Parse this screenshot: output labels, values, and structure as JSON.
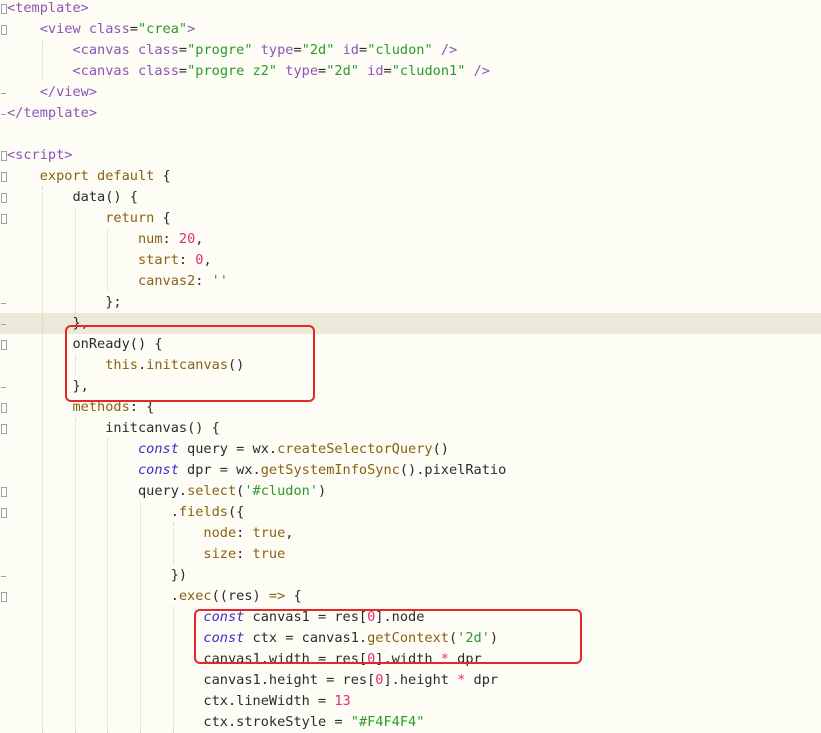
{
  "editor": {
    "lines": [
      [
        {
          "t": "<template>",
          "c": "tag"
        }
      ],
      [
        {
          "t": "    "
        },
        {
          "t": "<view ",
          "c": "tag"
        },
        {
          "t": "class",
          "c": "attr"
        },
        {
          "t": "=",
          "c": "punc"
        },
        {
          "t": "\"crea\"",
          "c": "str"
        },
        {
          "t": ">",
          "c": "tag"
        }
      ],
      [
        {
          "t": "        "
        },
        {
          "t": "<canvas ",
          "c": "tag"
        },
        {
          "t": "class",
          "c": "attr"
        },
        {
          "t": "=",
          "c": "punc"
        },
        {
          "t": "\"progre\"",
          "c": "str"
        },
        {
          "t": " "
        },
        {
          "t": "type",
          "c": "attr"
        },
        {
          "t": "=",
          "c": "punc"
        },
        {
          "t": "\"2d\"",
          "c": "str"
        },
        {
          "t": " "
        },
        {
          "t": "id",
          "c": "attr"
        },
        {
          "t": "=",
          "c": "punc"
        },
        {
          "t": "\"cludon\"",
          "c": "str"
        },
        {
          "t": " />",
          "c": "tag"
        }
      ],
      [
        {
          "t": "        "
        },
        {
          "t": "<canvas ",
          "c": "tag"
        },
        {
          "t": "class",
          "c": "attr"
        },
        {
          "t": "=",
          "c": "punc"
        },
        {
          "t": "\"progre z2\"",
          "c": "str"
        },
        {
          "t": " "
        },
        {
          "t": "type",
          "c": "attr"
        },
        {
          "t": "=",
          "c": "punc"
        },
        {
          "t": "\"2d\"",
          "c": "str"
        },
        {
          "t": " "
        },
        {
          "t": "id",
          "c": "attr"
        },
        {
          "t": "=",
          "c": "punc"
        },
        {
          "t": "\"cludon1\"",
          "c": "str"
        },
        {
          "t": " />",
          "c": "tag"
        }
      ],
      [
        {
          "t": "    "
        },
        {
          "t": "</view>",
          "c": "tag"
        }
      ],
      [
        {
          "t": "</template>",
          "c": "tag"
        }
      ],
      [],
      [
        {
          "t": "<script>",
          "c": "tag"
        }
      ],
      [
        {
          "t": "    "
        },
        {
          "t": "export default",
          "c": "kw"
        },
        {
          "t": " {",
          "c": "punc"
        }
      ],
      [
        {
          "t": "        "
        },
        {
          "t": "data",
          "c": "plain"
        },
        {
          "t": "() {",
          "c": "punc"
        }
      ],
      [
        {
          "t": "            "
        },
        {
          "t": "return",
          "c": "kw"
        },
        {
          "t": " {",
          "c": "punc"
        }
      ],
      [
        {
          "t": "                "
        },
        {
          "t": "num",
          "c": "prop"
        },
        {
          "t": ": ",
          "c": "punc"
        },
        {
          "t": "20",
          "c": "num"
        },
        {
          "t": ",",
          "c": "punc"
        }
      ],
      [
        {
          "t": "                "
        },
        {
          "t": "start",
          "c": "prop"
        },
        {
          "t": ": ",
          "c": "punc"
        },
        {
          "t": "0",
          "c": "num"
        },
        {
          "t": ",",
          "c": "punc"
        }
      ],
      [
        {
          "t": "                "
        },
        {
          "t": "canvas2",
          "c": "prop"
        },
        {
          "t": ": ",
          "c": "punc"
        },
        {
          "t": "''",
          "c": "str"
        }
      ],
      [
        {
          "t": "            "
        },
        {
          "t": "};",
          "c": "punc"
        }
      ],
      [
        {
          "t": "        "
        },
        {
          "t": "},",
          "c": "punc"
        }
      ],
      [
        {
          "t": "        "
        },
        {
          "t": "onReady",
          "c": "plain"
        },
        {
          "t": "() {",
          "c": "punc"
        }
      ],
      [
        {
          "t": "            "
        },
        {
          "t": "this",
          "c": "kw"
        },
        {
          "t": ".",
          "c": "punc"
        },
        {
          "t": "initcanvas",
          "c": "fn"
        },
        {
          "t": "()",
          "c": "punc"
        }
      ],
      [
        {
          "t": "        "
        },
        {
          "t": "},",
          "c": "punc"
        }
      ],
      [
        {
          "t": "        "
        },
        {
          "t": "methods",
          "c": "prop"
        },
        {
          "t": ": {",
          "c": "punc"
        }
      ],
      [
        {
          "t": "            "
        },
        {
          "t": "initcanvas",
          "c": "plain"
        },
        {
          "t": "() {",
          "c": "punc"
        }
      ],
      [
        {
          "t": "                "
        },
        {
          "t": "const",
          "c": "type"
        },
        {
          "t": " query = wx.",
          "c": "plain"
        },
        {
          "t": "createSelectorQuery",
          "c": "fn"
        },
        {
          "t": "()",
          "c": "punc"
        }
      ],
      [
        {
          "t": "                "
        },
        {
          "t": "const",
          "c": "type"
        },
        {
          "t": " dpr = wx.",
          "c": "plain"
        },
        {
          "t": "getSystemInfoSync",
          "c": "fn"
        },
        {
          "t": "().pixelRatio",
          "c": "plain"
        }
      ],
      [
        {
          "t": "                "
        },
        {
          "t": "query.",
          "c": "plain"
        },
        {
          "t": "select",
          "c": "fn"
        },
        {
          "t": "(",
          "c": "punc"
        },
        {
          "t": "'#cludon'",
          "c": "str"
        },
        {
          "t": ")",
          "c": "punc"
        }
      ],
      [
        {
          "t": "                    "
        },
        {
          "t": ".",
          "c": "punc"
        },
        {
          "t": "fields",
          "c": "fn"
        },
        {
          "t": "({",
          "c": "punc"
        }
      ],
      [
        {
          "t": "                        "
        },
        {
          "t": "node",
          "c": "prop"
        },
        {
          "t": ": ",
          "c": "punc"
        },
        {
          "t": "true",
          "c": "kw"
        },
        {
          "t": ",",
          "c": "punc"
        }
      ],
      [
        {
          "t": "                        "
        },
        {
          "t": "size",
          "c": "prop"
        },
        {
          "t": ": ",
          "c": "punc"
        },
        {
          "t": "true",
          "c": "kw"
        }
      ],
      [
        {
          "t": "                    "
        },
        {
          "t": "})",
          "c": "punc"
        }
      ],
      [
        {
          "t": "                    "
        },
        {
          "t": ".",
          "c": "punc"
        },
        {
          "t": "exec",
          "c": "fn"
        },
        {
          "t": "((res) ",
          "c": "plain"
        },
        {
          "t": "=>",
          "c": "kw"
        },
        {
          "t": " {",
          "c": "punc"
        }
      ],
      [
        {
          "t": "                        "
        },
        {
          "t": "const",
          "c": "type"
        },
        {
          "t": " canvas1 = res[",
          "c": "plain"
        },
        {
          "t": "0",
          "c": "num"
        },
        {
          "t": "].node",
          "c": "plain"
        }
      ],
      [
        {
          "t": "                        "
        },
        {
          "t": "const",
          "c": "type"
        },
        {
          "t": " ctx = canvas1.",
          "c": "plain"
        },
        {
          "t": "getContext",
          "c": "fn"
        },
        {
          "t": "(",
          "c": "punc"
        },
        {
          "t": "'2d'",
          "c": "str"
        },
        {
          "t": ")",
          "c": "punc"
        }
      ],
      [
        {
          "t": "                        "
        },
        {
          "t": "canvas1.width = res[",
          "c": "plain"
        },
        {
          "t": "0",
          "c": "num"
        },
        {
          "t": "].width ",
          "c": "plain"
        },
        {
          "t": "*",
          "c": "op"
        },
        {
          "t": " dpr",
          "c": "plain"
        }
      ],
      [
        {
          "t": "                        "
        },
        {
          "t": "canvas1.height = res[",
          "c": "plain"
        },
        {
          "t": "0",
          "c": "num"
        },
        {
          "t": "].height ",
          "c": "plain"
        },
        {
          "t": "*",
          "c": "op"
        },
        {
          "t": " dpr",
          "c": "plain"
        }
      ],
      [
        {
          "t": "                        "
        },
        {
          "t": "ctx.lineWidth = ",
          "c": "plain"
        },
        {
          "t": "13",
          "c": "num"
        }
      ],
      [
        {
          "t": "                        "
        },
        {
          "t": "ctx.strokeStyle = ",
          "c": "plain"
        },
        {
          "t": "\"#F4F4F4\"",
          "c": "str"
        }
      ]
    ],
    "fold_markers": [
      "open",
      "open",
      "",
      "",
      "close",
      "close",
      "",
      "open",
      "open",
      "open",
      "open",
      "",
      "",
      "",
      "close",
      "close",
      "open",
      "",
      "close",
      "open",
      "open",
      "",
      "",
      "open",
      "open",
      "",
      "",
      "close",
      "open",
      "",
      "",
      "",
      "",
      "",
      ""
    ],
    "highlighted_line_index": 15,
    "colors": {
      "background": "#fdfcf5",
      "current_line": "#ece9d8",
      "annotation_box": "#e5262b"
    }
  }
}
